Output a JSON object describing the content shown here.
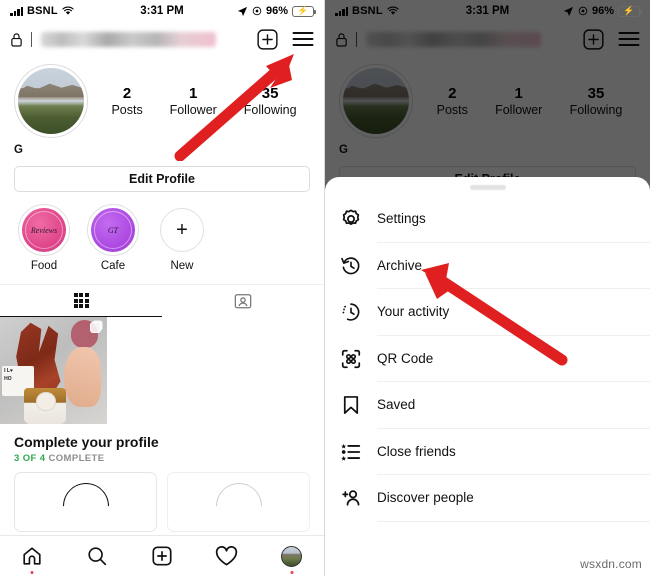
{
  "status_bar": {
    "carrier": "BSNL",
    "time": "3:31 PM",
    "battery_percent": "96%",
    "signal_icon": "signal-bars-icon",
    "wifi_icon": "wifi-icon",
    "location_icon": "location-arrow-icon",
    "alarm_icon": "alarm-icon",
    "battery_icon": "battery-charging-icon"
  },
  "header": {
    "lock_icon": "lock-icon",
    "username_value": "",
    "add_icon": "add-post-icon",
    "menu_icon": "hamburger-menu-icon"
  },
  "profile": {
    "avatar_icon": "profile-avatar",
    "display_name": "G",
    "stats": [
      {
        "num": "2",
        "label": "Posts"
      },
      {
        "num": "1",
        "label": "Follower"
      },
      {
        "num": "35",
        "label": "Following"
      }
    ],
    "edit_profile_label": "Edit Profile",
    "highlights": [
      {
        "label": "Food",
        "cover_text": "Reviews",
        "color": "#e5558f"
      },
      {
        "label": "Cafe",
        "cover_text": "GT",
        "color": "#b44ae0"
      },
      {
        "label": "New",
        "cover_text": "+",
        "color": "#ffffff"
      }
    ],
    "tabs": [
      {
        "name": "grid-tab",
        "icon": "grid-icon",
        "active": true
      },
      {
        "name": "tagged-tab",
        "icon": "tagged-person-icon",
        "active": false
      }
    ]
  },
  "complete_profile": {
    "title": "Complete your profile",
    "progress_done": "3 OF 4",
    "progress_rest": "COMPLETE",
    "accent_color": "#2fa84f"
  },
  "bottom_nav": [
    {
      "name": "home-tab",
      "icon": "home-icon",
      "badge": true
    },
    {
      "name": "search-tab",
      "icon": "search-icon",
      "badge": false
    },
    {
      "name": "create-tab",
      "icon": "add-box-icon",
      "badge": false
    },
    {
      "name": "activity-tab",
      "icon": "heart-icon",
      "badge": false
    },
    {
      "name": "profile-tab",
      "icon": "avatar-icon",
      "badge": true
    }
  ],
  "menu_sheet": {
    "handle": "drag-handle",
    "items": [
      {
        "label": "Settings",
        "icon": "gear-icon"
      },
      {
        "label": "Archive",
        "icon": "archive-clock-icon"
      },
      {
        "label": "Your activity",
        "icon": "activity-clock-icon"
      },
      {
        "label": "QR Code",
        "icon": "qr-code-icon"
      },
      {
        "label": "Saved",
        "icon": "bookmark-icon"
      },
      {
        "label": "Close friends",
        "icon": "close-friends-list-icon"
      },
      {
        "label": "Discover people",
        "icon": "add-person-icon"
      }
    ]
  },
  "annotations": {
    "arrow_color": "#e02020",
    "left_arrow_target": "hamburger-menu-icon",
    "right_arrow_target": "Archive"
  },
  "watermark": "wsxdn.com"
}
